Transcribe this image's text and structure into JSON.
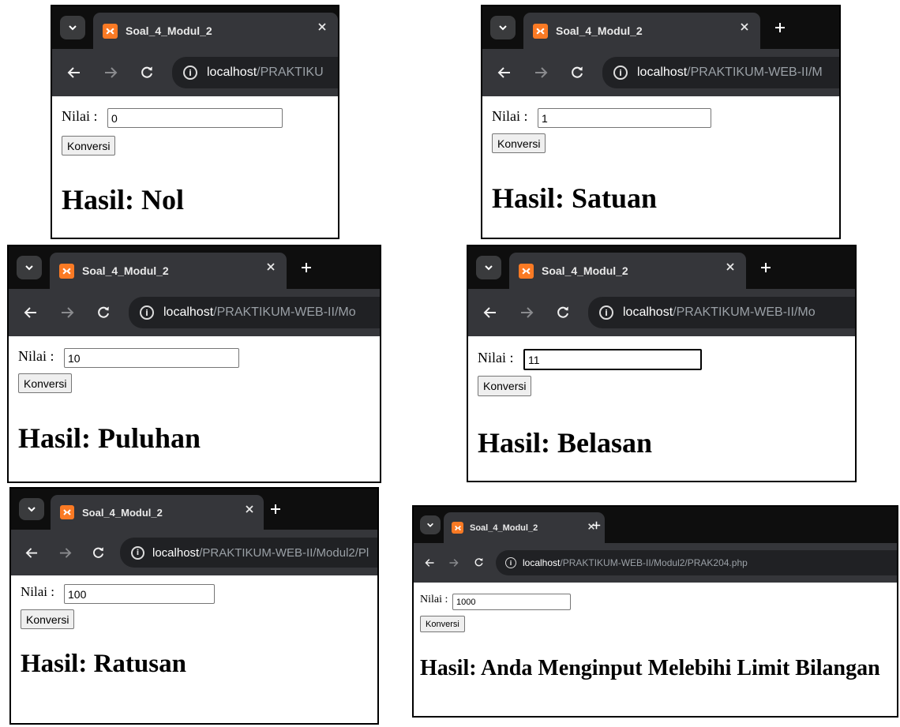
{
  "tab_title": "Soal_4_Modul_2",
  "url_host": "localhost",
  "input_label": "Nilai :",
  "button_label": "Konversi",
  "panels": [
    {
      "url_path": "/PRAKTIKU",
      "input_value": "0",
      "result": "Hasil: Nol"
    },
    {
      "url_path": "/PRAKTIKUM-WEB-II/M",
      "input_value": "1",
      "result": "Hasil: Satuan"
    },
    {
      "url_path": "/PRAKTIKUM-WEB-II/Mo",
      "input_value": "10",
      "result": "Hasil: Puluhan"
    },
    {
      "url_path": "/PRAKTIKUM-WEB-II/Mo",
      "input_value": "11",
      "result": "Hasil: Belasan"
    },
    {
      "url_path": "/PRAKTIKUM-WEB-II/Modul2/Pl",
      "input_value": "100",
      "result": "Hasil: Ratusan"
    },
    {
      "url_path": "/PRAKTIKUM-WEB-II/Modul2/PRAK204.php",
      "input_value": "1000",
      "result": "Hasil: Anda Menginput Melebihi Limit Bilangan"
    }
  ],
  "colors": {
    "tab_strip": "#0e0e0e",
    "active_tab": "#35363a",
    "omnibox": "#202124",
    "favicon": "#fb7a24",
    "url_path": "#9aa0a6"
  }
}
